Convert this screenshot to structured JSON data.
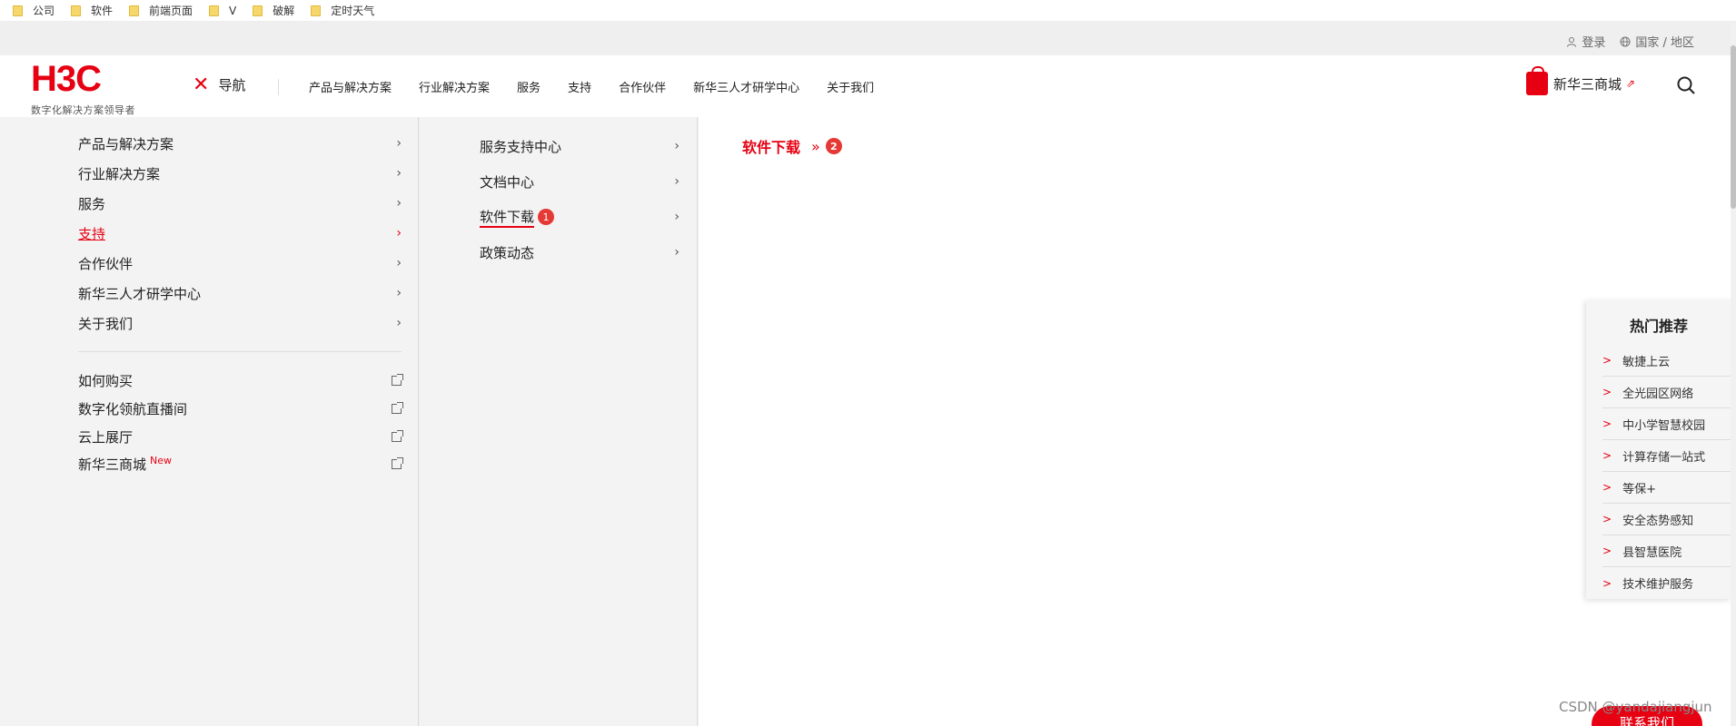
{
  "bookmarks": [
    "公司",
    "软件",
    "前端页面",
    "V",
    "破解",
    "定时天气"
  ],
  "util": {
    "login": "登录",
    "region": "国家 / 地区"
  },
  "logo": {
    "brand": "H3C",
    "slogan": "数字化解决方案领导者"
  },
  "nav_toggle": {
    "label": "导航",
    "close_symbol": "✕"
  },
  "main_nav": [
    "产品与解决方案",
    "行业解决方案",
    "服务",
    "支持",
    "合作伙伴",
    "新华三人才研学中心",
    "关于我们"
  ],
  "shop": {
    "label": "新华三商城",
    "ext_symbol": "⇗"
  },
  "menu_level1": [
    {
      "label": "产品与解决方案",
      "active": false
    },
    {
      "label": "行业解决方案",
      "active": false
    },
    {
      "label": "服务",
      "active": false
    },
    {
      "label": "支持",
      "active": true
    },
    {
      "label": "合作伙伴",
      "active": false
    },
    {
      "label": "新华三人才研学中心",
      "active": false
    },
    {
      "label": "关于我们",
      "active": false
    }
  ],
  "menu_links": [
    {
      "label": "如何购买"
    },
    {
      "label": "数字化领航直播间"
    },
    {
      "label": "云上展厅"
    },
    {
      "label": "新华三商城",
      "tag": "New"
    }
  ],
  "menu_level2": [
    {
      "label": "服务支持中心"
    },
    {
      "label": "文档中心"
    },
    {
      "label": "软件下载",
      "active": true,
      "badge": "1"
    },
    {
      "label": "政策动态"
    }
  ],
  "breadcrumb": {
    "label": "软件下载",
    "arrows": "»",
    "badge": "2"
  },
  "hot": {
    "title": "热门推荐",
    "items": [
      "敏捷上云",
      "全光园区网络",
      "中小学智慧校园",
      "计算存储一站式",
      "等保+",
      "安全态势感知",
      "县智慧医院",
      "技术维护服务"
    ]
  },
  "chevron": "›",
  "item_marker": ">",
  "watermark": "CSDN @yandajiangjun",
  "contact_label": "联系我们",
  "colors": {
    "brand_red": "#e60012",
    "badge_red": "#e53935",
    "panel_gray": "#f3f3f3"
  }
}
